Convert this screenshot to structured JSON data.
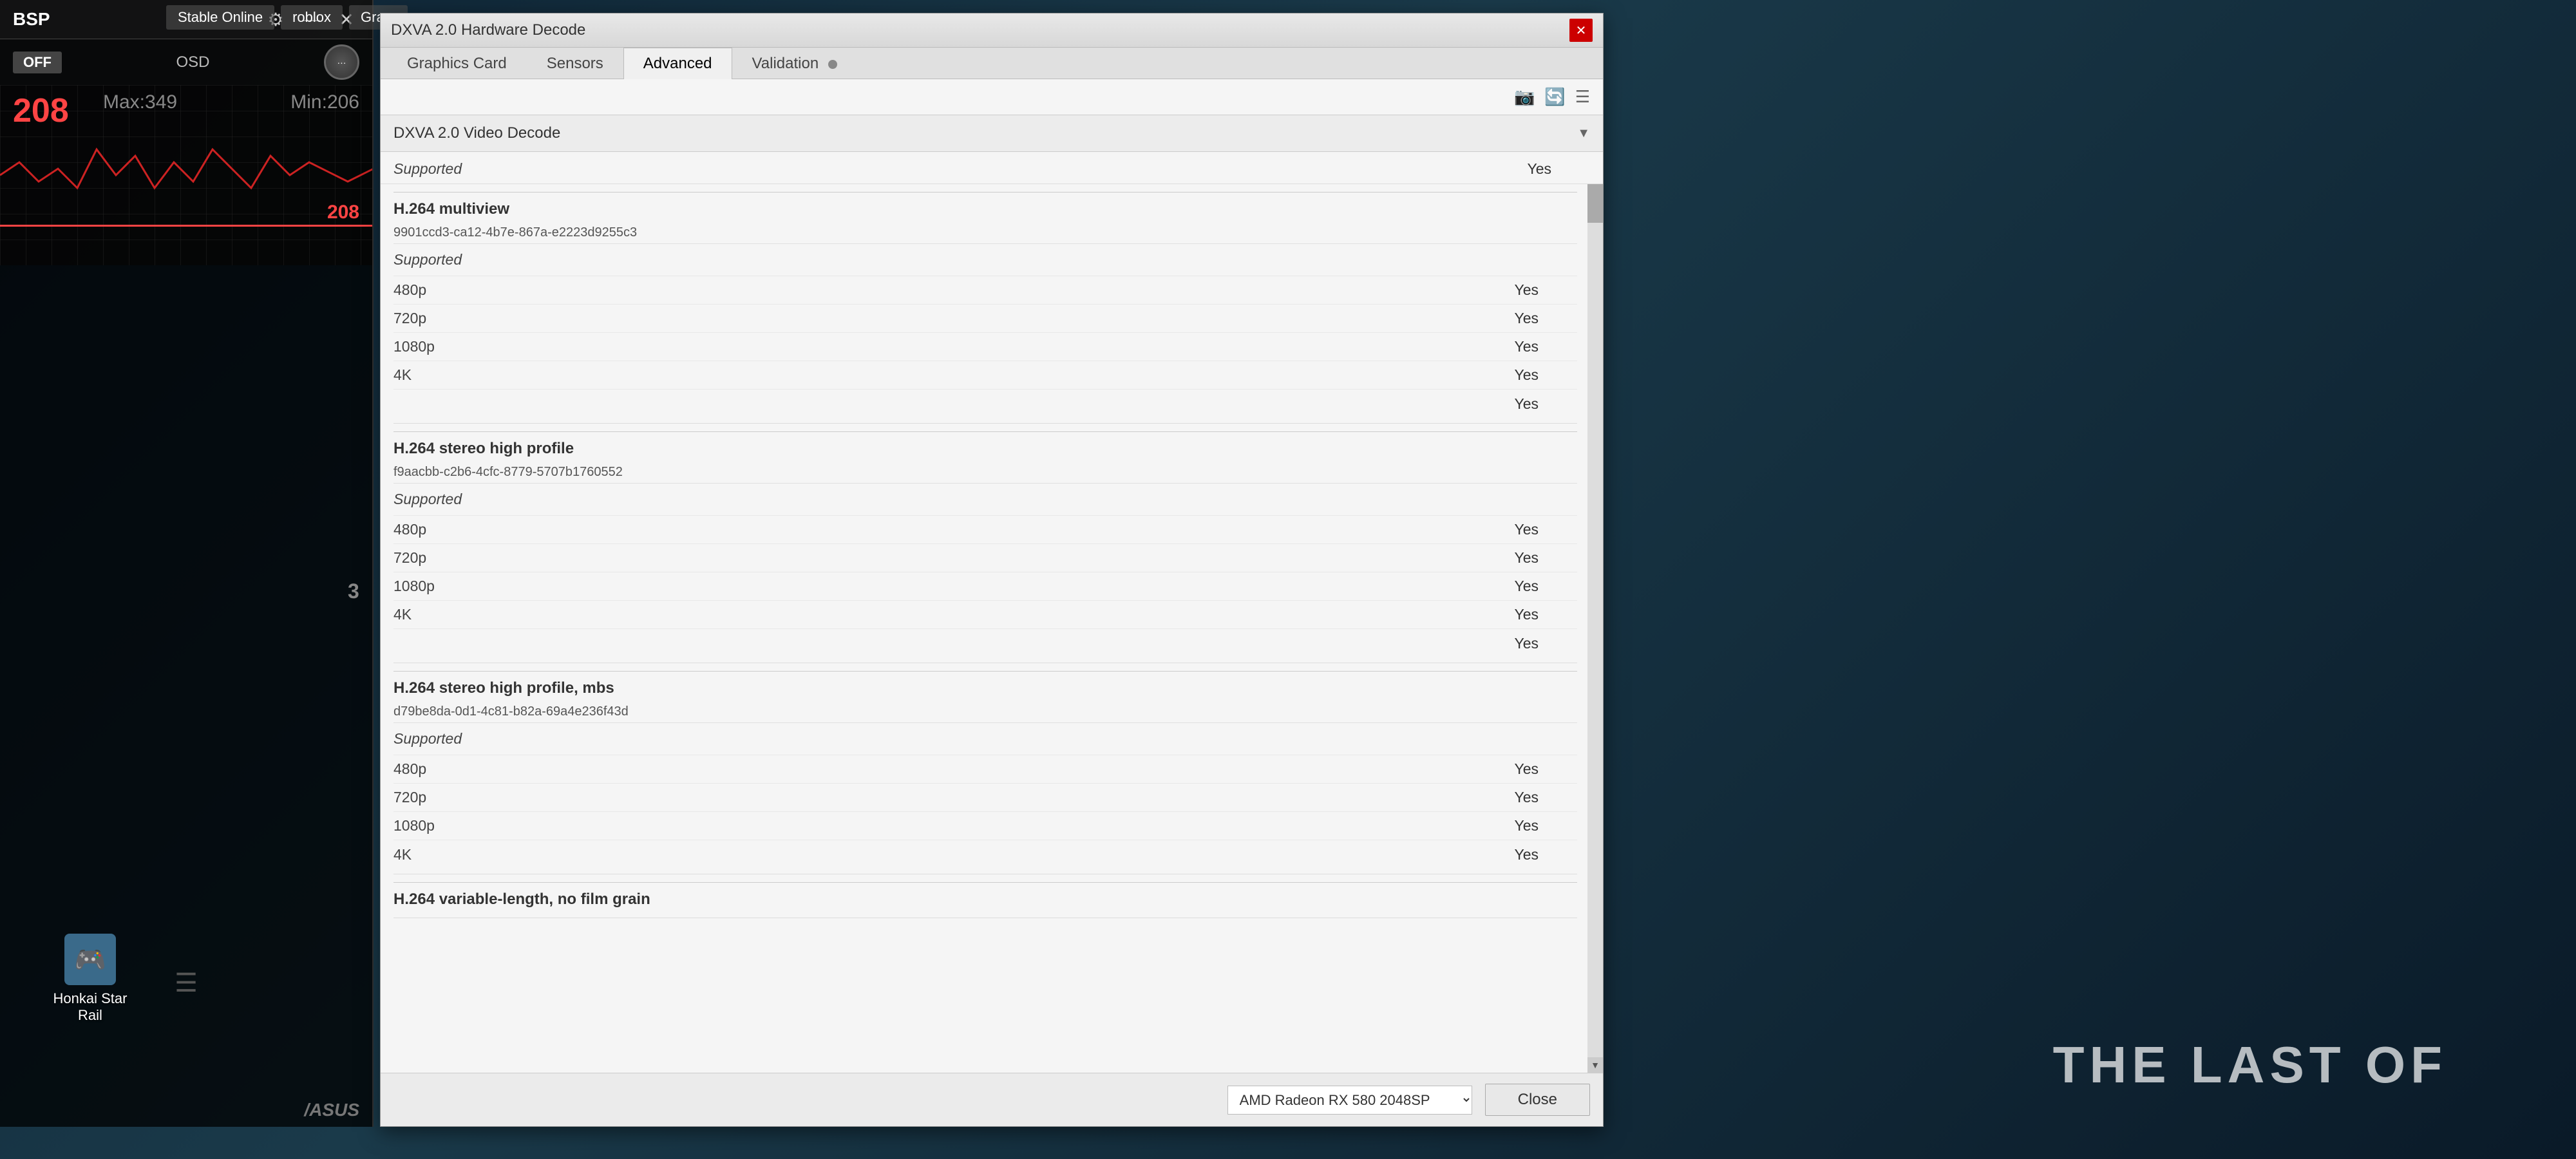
{
  "desktop": {
    "background_color": "#1a3a4a"
  },
  "taskbar": {
    "items": [
      {
        "label": "Stable Online"
      },
      {
        "label": "roblox"
      },
      {
        "label": "Gra..."
      }
    ]
  },
  "osd": {
    "brand": "BSP",
    "controls": {
      "settings_icon": "⚙",
      "minimize_icon": "—",
      "close_icon": "✕"
    },
    "off_label": "OFF",
    "osd_label": "OSD",
    "current_value": "208",
    "max_label": "Max:349",
    "min_label": "Min:206",
    "red_value": "208",
    "asus_logo": "/ASUS"
  },
  "dialog": {
    "title": "DXVA 2.0 Hardware Decode",
    "close_icon": "✕",
    "tabs": [
      {
        "label": "Graphics Card",
        "active": false
      },
      {
        "label": "Sensors",
        "active": false
      },
      {
        "label": "Advanced",
        "active": true
      },
      {
        "label": "Validation",
        "active": false,
        "has_dot": true
      }
    ],
    "section_dropdown": {
      "label": "DXVA 2.0 Video Decode",
      "arrow": "▼"
    },
    "top_value": "Yes",
    "sections": [
      {
        "heading": "H.264 multiview",
        "guid": "9901ccd3-ca12-4b7e-867a-e2223d9255c3",
        "supported": "Supported",
        "rows": [
          {
            "label": "480p",
            "value": "Yes"
          },
          {
            "label": "720p",
            "value": "Yes"
          },
          {
            "label": "1080p",
            "value": "Yes"
          },
          {
            "label": "4K",
            "value": "Yes"
          },
          {
            "label": "",
            "value": "Yes"
          }
        ]
      },
      {
        "heading": "H.264 stereo high profile",
        "guid": "f9aacbb-c2b6-4cfc-8779-5707b1760552",
        "supported": "Supported",
        "rows": [
          {
            "label": "480p",
            "value": "Yes"
          },
          {
            "label": "720p",
            "value": "Yes"
          },
          {
            "label": "1080p",
            "value": "Yes"
          },
          {
            "label": "4K",
            "value": "Yes"
          },
          {
            "label": "",
            "value": "Yes"
          }
        ]
      },
      {
        "heading": "H.264 stereo high profile, mbs",
        "guid": "d79be8da-0d1-4c81-b82a-69a4e236f43d",
        "supported": "Supported",
        "rows": [
          {
            "label": "480p",
            "value": "Yes"
          },
          {
            "label": "720p",
            "value": "Yes"
          },
          {
            "label": "1080p",
            "value": "Yes"
          },
          {
            "label": "4K",
            "value": "Yes"
          }
        ]
      },
      {
        "heading": "H.264 variable-length, no film grain",
        "guid": "",
        "supported": "",
        "rows": []
      }
    ],
    "footer": {
      "gpu_select": "AMD Radeon RX 580 2048SP",
      "close_button": "Close"
    },
    "toolbar_icons": [
      "📷",
      "🔄",
      "☰"
    ]
  },
  "desktop_icons": [
    {
      "label": "Honkai Star Rail",
      "icon": "🎮"
    }
  ],
  "number_indicator": "3",
  "game_title": "THE LAST OF"
}
